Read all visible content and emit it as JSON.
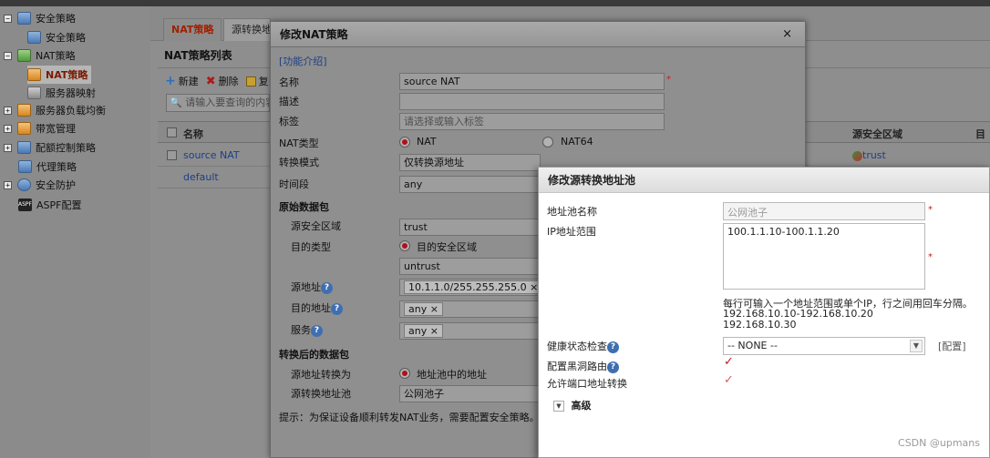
{
  "tree": {
    "items": [
      {
        "label": "安全策略"
      },
      {
        "label": "安全策略"
      },
      {
        "label": "NAT策略"
      },
      {
        "label": "NAT策略"
      },
      {
        "label": "服务器映射"
      },
      {
        "label": "服务器负载均衡"
      },
      {
        "label": "带宽管理"
      },
      {
        "label": "配额控制策略"
      },
      {
        "label": "代理策略"
      },
      {
        "label": "安全防护"
      },
      {
        "label": "ASPF配置"
      }
    ]
  },
  "main": {
    "tabs": [
      "NAT策略",
      "源转换地"
    ],
    "list_title": "NAT策略列表",
    "toolbar": {
      "new": "新建",
      "delete": "删除",
      "copy": "复"
    },
    "search_placeholder": "请输入要查询的内容",
    "columns": {
      "name": "名称",
      "src_zone": "源安全区域",
      "dst_prefix": "目"
    },
    "rows": [
      {
        "name": "source NAT",
        "src_zone": "trust"
      },
      {
        "name": "default",
        "src_zone": ""
      }
    ]
  },
  "nat_dialog": {
    "title": "修改NAT策略",
    "help_link": "[功能介绍]",
    "name_label": "名称",
    "name_value": "source NAT",
    "desc_label": "描述",
    "tag_label": "标签",
    "tag_placeholder": "请选择或输入标签",
    "nat_type_label": "NAT类型",
    "nat_type_options": [
      "NAT",
      "NAT64"
    ],
    "mode_label": "转换模式",
    "mode_value": "仅转换源地址",
    "time_label": "时间段",
    "time_value": "any",
    "orig_section": "原始数据包",
    "src_zone_label": "源安全区域",
    "src_zone_value": "trust",
    "dst_type_label": "目的类型",
    "dst_type_option": "目的安全区域",
    "dst_zone_value": "untrust",
    "src_addr_label": "源地址",
    "src_addr_value": "10.1.1.0/255.255.255.0",
    "dst_addr_label": "目的地址",
    "dst_addr_value": "any",
    "service_label": "服务",
    "service_value": "any",
    "after_section": "转换后的数据包",
    "src_trans_label": "源地址转换为",
    "src_trans_option": "地址池中的地址",
    "pool_label": "源转换地址池",
    "pool_value": "公网池子",
    "hint": "提示：为保证设备顺利转发NAT业务，需要配置安全策略。[",
    "close_glyph": "×",
    "tag_remove": "×"
  },
  "pool_dialog": {
    "title": "修改源转换地址池",
    "name_label": "地址池名称",
    "name_value": "公网池子",
    "range_label": "IP地址范围",
    "range_value": "100.1.1.10-100.1.1.20",
    "range_hint_1": "每行可输入一个地址范围或单个IP，行之间用回车分隔。",
    "range_hint_2": "192.168.10.10-192.168.10.20",
    "range_hint_3": "192.168.10.30",
    "health_label": "健康状态检查",
    "health_value": "-- NONE --",
    "config_link": "[配置]",
    "blackhole_label": "配置黑洞路由",
    "port_trans_label": "允许端口地址转换",
    "advanced_label": "高级"
  },
  "watermark": "CSDN @upmans"
}
